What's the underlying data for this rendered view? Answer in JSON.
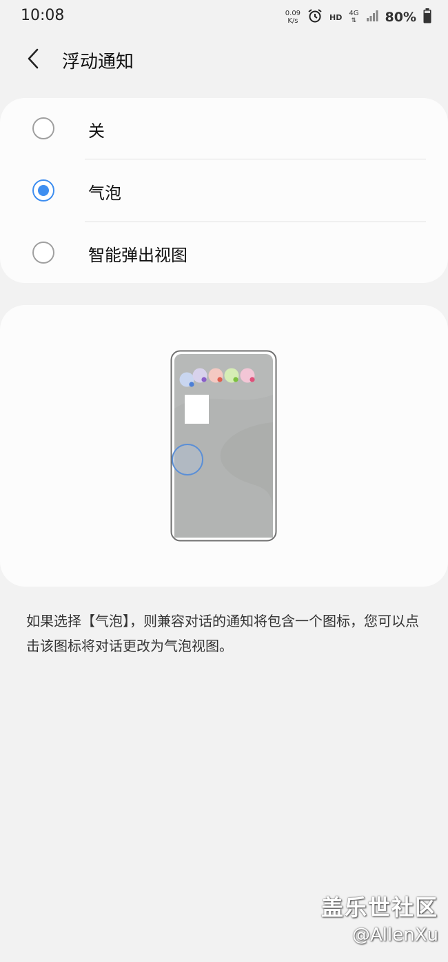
{
  "status_bar": {
    "time": "10:08",
    "net_speed_value": "0.09",
    "net_speed_unit": "K/s",
    "hd": "HD",
    "network": "4G",
    "battery": "80%",
    "icons": [
      "alarm-icon",
      "signal-icon",
      "battery-icon"
    ]
  },
  "header": {
    "title": "浮动通知",
    "back_icon": "chevron-left-icon"
  },
  "options": [
    {
      "label": "关",
      "selected": false
    },
    {
      "label": "气泡",
      "selected": true
    },
    {
      "label": "智能弹出视图",
      "selected": false
    }
  ],
  "preview": {
    "illustration": "phone-with-bubbles",
    "bubble_colors": [
      "#c9d6f0",
      "#d8d2ec",
      "#f4c9c2",
      "#d6edb5",
      "#f3c6d6"
    ],
    "badge_colors": [
      "#4c7fd6",
      "#8a5fc9",
      "#e06050",
      "#7cc140",
      "#e0507a"
    ]
  },
  "description": "如果选择【气泡】，则兼容对话的通知将包含一个图标，您可以点击该图标将对话更改为气泡视图。",
  "watermark": {
    "title": "盖乐世社区",
    "user": "@AllenXu"
  },
  "colors": {
    "background": "#f2f2f2",
    "card": "#fcfcfc",
    "accent": "#3e8ef0"
  }
}
